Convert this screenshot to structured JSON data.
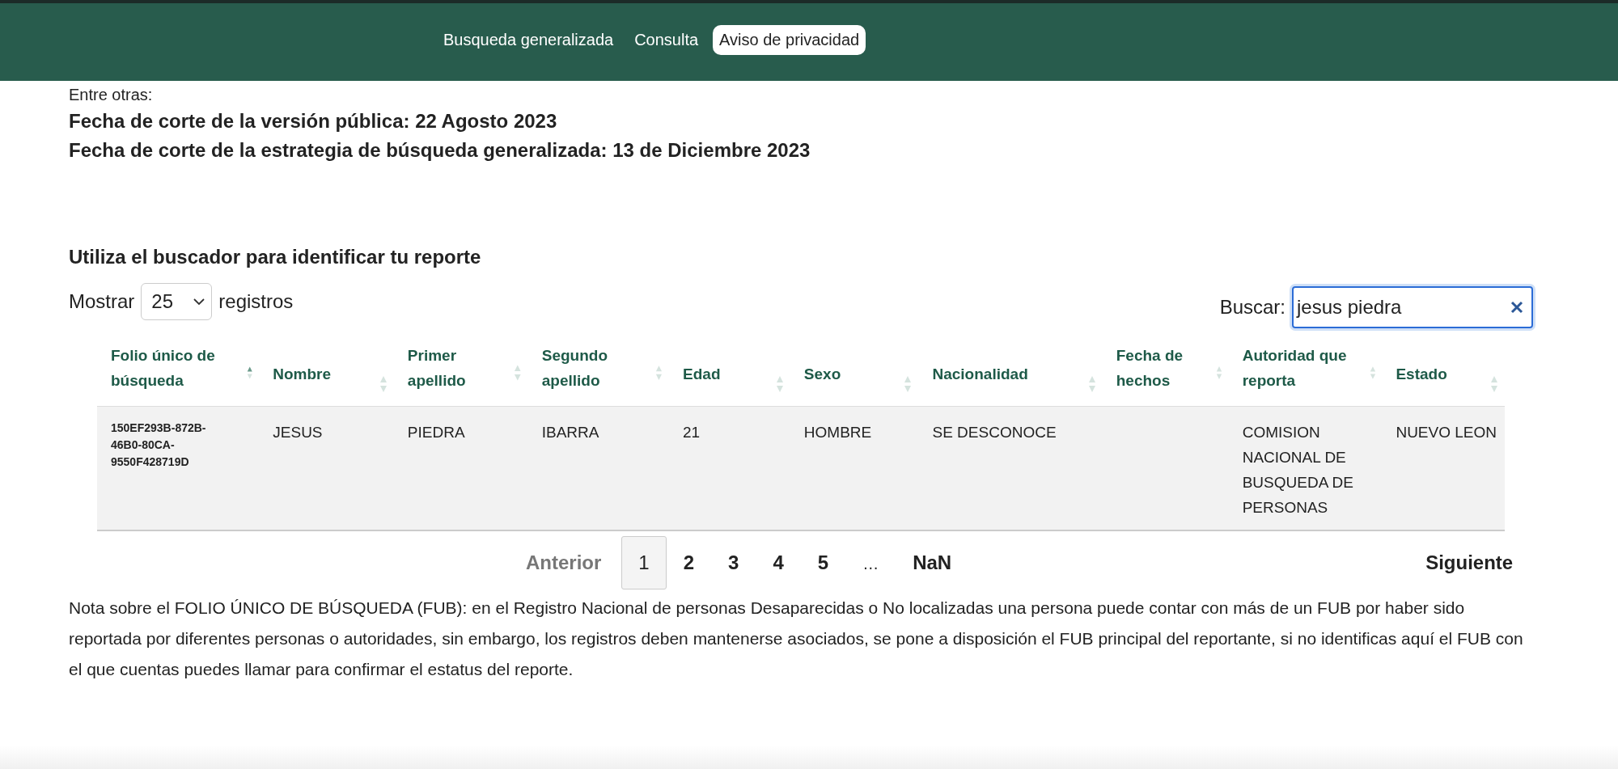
{
  "nav": [
    {
      "label": "Busqueda generalizada",
      "selected": false
    },
    {
      "label": "Consulta",
      "selected": false
    },
    {
      "label": "Aviso de privacidad",
      "selected": true
    }
  ],
  "intro": "Entre otras:",
  "dates": [
    "Fecha de corte de la versión pública: 22 Agosto 2023",
    "Fecha de corte de la estrategia de búsqueda generalizada: 13 de Diciembre 2023"
  ],
  "search_heading": "Utiliza el buscador para identificar tu reporte",
  "length": {
    "before": "Mostrar",
    "value": "25",
    "after": "registros"
  },
  "search": {
    "label": "Buscar:",
    "value": "jesus piedra"
  },
  "table": {
    "columns": [
      {
        "label": "Folio único de búsqueda",
        "sorted": true
      },
      {
        "label": "Nombre",
        "sorted": false
      },
      {
        "label": "Primer apellido",
        "sorted": false
      },
      {
        "label": "Segundo apellido",
        "sorted": false
      },
      {
        "label": "Edad",
        "sorted": false
      },
      {
        "label": "Sexo",
        "sorted": false
      },
      {
        "label": "Nacionalidad",
        "sorted": false
      },
      {
        "label": "Fecha de hechos",
        "sorted": false
      },
      {
        "label": "Autoridad que reporta",
        "sorted": false
      },
      {
        "label": "Estado",
        "sorted": false
      }
    ],
    "rows": [
      [
        "150EF293B-872B-46B0-80CA-9550F428719D",
        "JESUS",
        "PIEDRA",
        "IBARRA",
        "21",
        "HOMBRE",
        "SE DESCONOCE",
        "",
        "COMISION NACIONAL DE BUSQUEDA DE PERSONAS",
        "NUEVO LEON"
      ]
    ]
  },
  "pagination": {
    "previous": {
      "label": "Anterior",
      "disabled": true
    },
    "pages": [
      {
        "label": "1",
        "kind": "page",
        "selected": true
      },
      {
        "label": "2",
        "kind": "page",
        "selected": false
      },
      {
        "label": "3",
        "kind": "page",
        "selected": false
      },
      {
        "label": "4",
        "kind": "page",
        "selected": false
      },
      {
        "label": "5",
        "kind": "page",
        "selected": false
      },
      {
        "label": "…",
        "kind": "ellipsis",
        "selected": false
      },
      {
        "label": "NaN",
        "kind": "page",
        "selected": false
      }
    ],
    "next": {
      "label": "Siguiente",
      "disabled": false
    }
  },
  "note": "Nota sobre el FOLIO ÚNICO DE BÚSQUEDA (FUB): en el Registro Nacional de personas Desaparecidas o No localizadas una persona puede contar con más de un FUB por haber sido reportada por diferentes personas o autoridades, sin embargo, los registros deben mantenerse asociados, se pone a disposición el FUB principal del reportante, si no identificas aquí el FUB con el que cuentas puedes llamar para confirmar el estatus del reporte."
}
